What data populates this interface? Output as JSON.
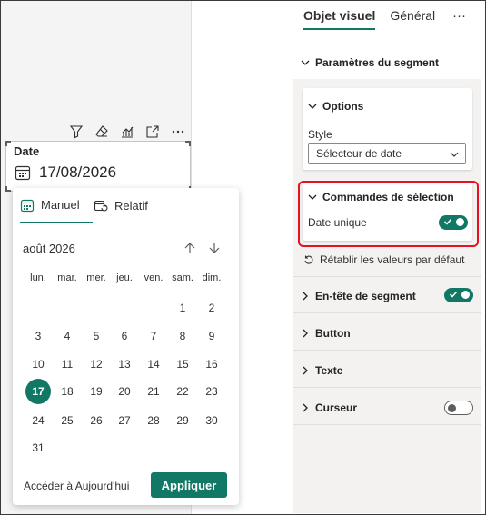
{
  "canvas": {
    "toolbar_icons": [
      "filter-icon",
      "eraser-icon",
      "analytics-icon",
      "focus-mode-icon",
      "more-options-icon"
    ],
    "slicer": {
      "title": "Date",
      "value": "17/08/2026"
    }
  },
  "popup": {
    "tabs": [
      {
        "label": "Manuel",
        "icon": "calendar-icon",
        "active": true
      },
      {
        "label": "Relatif",
        "icon": "refresh-calendar-icon",
        "active": false
      }
    ],
    "month_label": "août 2026",
    "weekdays": [
      "lun.",
      "mar.",
      "mer.",
      "jeu.",
      "ven.",
      "sam.",
      "dim."
    ],
    "weeks": [
      [
        "",
        "",
        "",
        "",
        "",
        "1",
        "2"
      ],
      [
        "3",
        "4",
        "5",
        "6",
        "7",
        "8",
        "9"
      ],
      [
        "10",
        "11",
        "12",
        "13",
        "14",
        "15",
        "16"
      ],
      [
        "17",
        "18",
        "19",
        "20",
        "21",
        "22",
        "23"
      ],
      [
        "24",
        "25",
        "26",
        "27",
        "28",
        "29",
        "30"
      ],
      [
        "31",
        "",
        "",
        "",
        "",
        "",
        ""
      ]
    ],
    "selected_day": "17",
    "today_link": "Accéder à Aujourd'hui",
    "apply_label": "Appliquer",
    "accent_color": "#117865"
  },
  "pane": {
    "tabs": [
      "Objet visuel",
      "Général"
    ],
    "more": "···",
    "slicer_settings_title": "Paramètres du segment",
    "options": {
      "title": "Options",
      "style_label": "Style",
      "style_value": "Sélecteur de date"
    },
    "selection_controls": {
      "title": "Commandes de sélection",
      "single_date_label": "Date unique",
      "single_date_on": true
    },
    "reset_label": "Rétablir les valeurs par défaut",
    "sections": [
      {
        "label": "En-tête de segment",
        "toggle": "on"
      },
      {
        "label": "Button",
        "toggle": "none"
      },
      {
        "label": "Texte",
        "toggle": "none"
      },
      {
        "label": "Curseur",
        "toggle": "off"
      }
    ]
  }
}
